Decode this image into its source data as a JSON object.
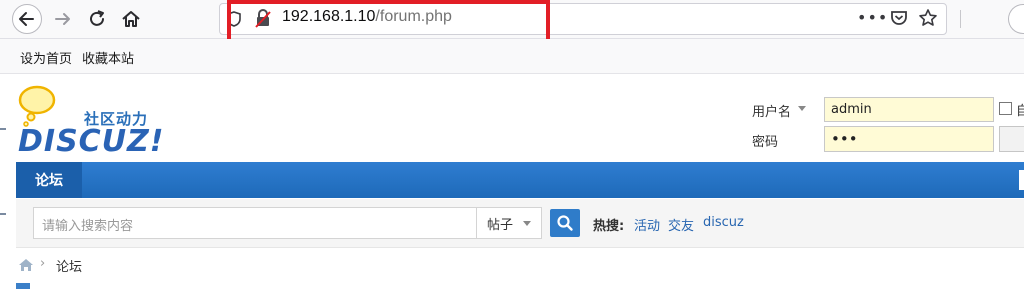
{
  "browser": {
    "url_host": "192.168.1.10",
    "url_path": "/forum.php",
    "more_icon": "more-icon",
    "bookmarks": [
      "设为首页",
      "收藏本站"
    ]
  },
  "header": {
    "tagline": "社区动力",
    "logo_text": "DISCUZ!"
  },
  "login": {
    "username_label": "用户名",
    "username_value": "admin",
    "password_label": "密码",
    "password_value": "•••",
    "remember_label": "自"
  },
  "nav": {
    "tabs": [
      {
        "label": "论坛"
      }
    ]
  },
  "search": {
    "placeholder": "请输入搜索内容",
    "type_label": "帖子",
    "hot_label": "热搜:",
    "hot_links": [
      "活动",
      "交友",
      "discuz"
    ]
  },
  "breadcrumb": {
    "current": "论坛"
  },
  "colors": {
    "accent": "#2f7cc9",
    "highlight": "#e21e26",
    "input_bg": "#fffbd6"
  }
}
